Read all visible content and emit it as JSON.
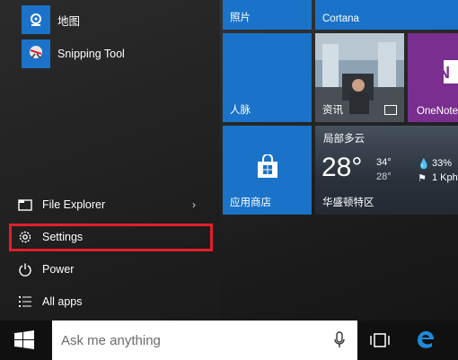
{
  "apps": [
    {
      "label": "地图",
      "icon": "maps-icon"
    },
    {
      "label": "Snipping Tool",
      "icon": "snipping-tool-icon"
    }
  ],
  "nav": {
    "file_explorer": "File Explorer",
    "settings": "Settings",
    "power": "Power",
    "all_apps": "All apps"
  },
  "tiles": {
    "photos": "照片",
    "cortana": "Cortana",
    "people": "人脉",
    "news": "资讯",
    "onenote": "OneNote",
    "store": "应用商店",
    "weather": {
      "condition": "局部多云",
      "temp": "28°",
      "high": "34°",
      "low": "28°",
      "humidity": "33%",
      "wind": "1 Kph",
      "location": "华盛顿特区"
    }
  },
  "taskbar": {
    "search_placeholder": "Ask me anything"
  },
  "colors": {
    "tile_blue": "#1a73c8",
    "onenote_purple": "#7a2e8f",
    "highlight_red": "#e0202a"
  }
}
